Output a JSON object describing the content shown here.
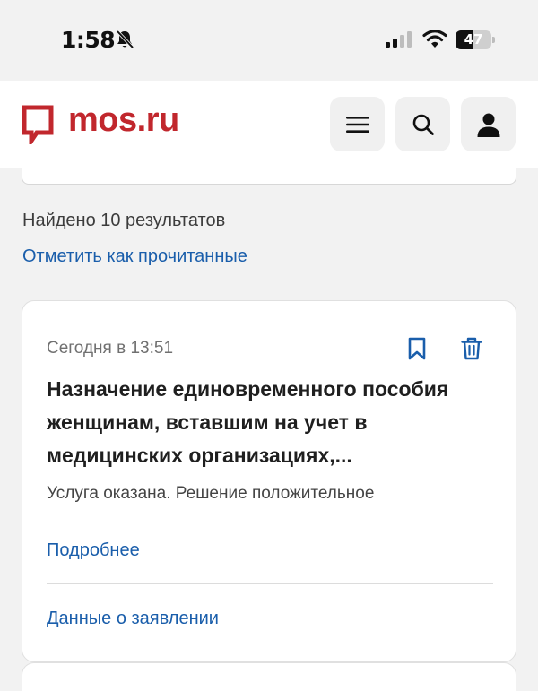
{
  "status_bar": {
    "time": "1:58",
    "battery_percent": 47,
    "battery_label": "47",
    "icons": [
      "bell-slash-icon",
      "cellular-signal-icon",
      "wifi-icon",
      "battery-icon"
    ]
  },
  "header": {
    "logo_text": "mos.ru",
    "brand_color": "#c1272d",
    "buttons": [
      "menu-icon",
      "search-icon",
      "user-icon"
    ]
  },
  "results": {
    "found_text": "Найдено 10 результатов",
    "mark_read_label": "Отметить как прочитанные"
  },
  "notification": {
    "date": "Сегодня в 13:51",
    "title": "Назначение единовременного пособия женщинам, вставшим на учет в медицинских организациях,...",
    "status": "Услуга оказана. Решение положительное",
    "more_label": "Подробнее",
    "details_label": "Данные о заявлении",
    "icons": [
      "bookmark-icon",
      "trash-icon"
    ]
  },
  "colors": {
    "accent": "#1a5eab",
    "background": "#f2f2f2"
  }
}
